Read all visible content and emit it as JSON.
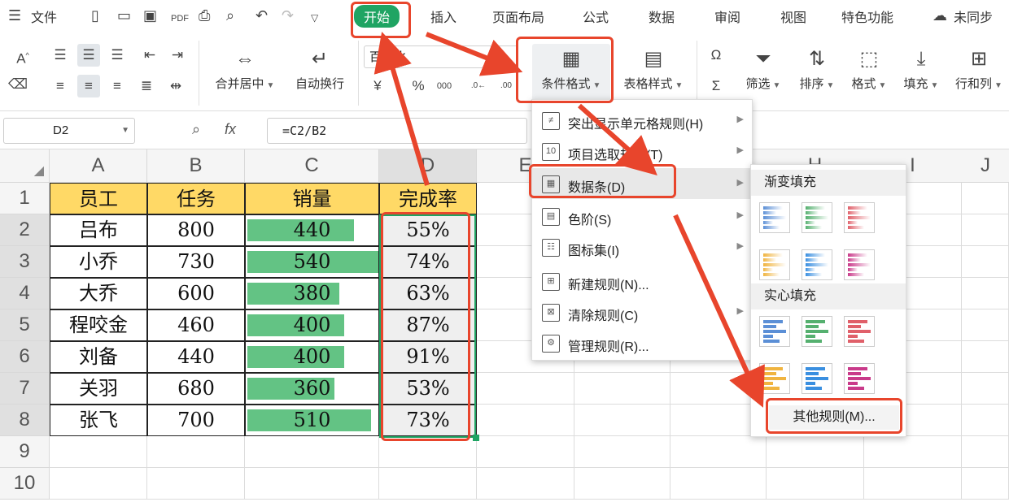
{
  "menubar": {
    "file_label": "文件",
    "tabs": [
      "开始",
      "插入",
      "页面布局",
      "公式",
      "数据",
      "审阅",
      "视图",
      "特色功能"
    ],
    "sync_label": "未同步"
  },
  "ribbon": {
    "merge_label": "合并居中",
    "wrap_label": "自动换行",
    "number_format": "百分比",
    "cond_format_label": "条件格式",
    "table_style_label": "表格样式",
    "filter_label": "筛选",
    "sort_label": "排序",
    "format_label": "格式",
    "fill_label": "填充",
    "rowcol_label": "行和列"
  },
  "formula_bar": {
    "name_box": "D2",
    "fx": "fx",
    "formula": "=C2/B2"
  },
  "columns": [
    "A",
    "B",
    "C",
    "D",
    "E",
    "H",
    "I",
    "J"
  ],
  "rows": [
    "1",
    "2",
    "3",
    "4",
    "5",
    "6",
    "7",
    "8",
    "9",
    "10"
  ],
  "table": {
    "headers": [
      "员工",
      "任务",
      "销量",
      "完成率"
    ],
    "data": [
      {
        "name": "吕布",
        "task": "800",
        "sales": "440",
        "rate": "55%",
        "bar": 0.55
      },
      {
        "name": "小乔",
        "task": "730",
        "sales": "540",
        "rate": "74%",
        "bar": 0.74
      },
      {
        "name": "大乔",
        "task": "600",
        "sales": "380",
        "rate": "63%",
        "bar": 0.63
      },
      {
        "name": "程咬金",
        "task": "460",
        "sales": "400",
        "rate": "87%",
        "bar": 0.87
      },
      {
        "name": "刘备",
        "task": "440",
        "sales": "400",
        "rate": "91%",
        "bar": 0.91
      },
      {
        "name": "关羽",
        "task": "680",
        "sales": "360",
        "rate": "53%",
        "bar": 0.53
      },
      {
        "name": "张飞",
        "task": "700",
        "sales": "510",
        "rate": "73%",
        "bar": 0.73
      }
    ]
  },
  "cond_menu": {
    "items": [
      "突出显示单元格规则(H)",
      "项目选取规则(T)",
      "数据条(D)",
      "色阶(S)",
      "图标集(I)",
      "新建规则(N)...",
      "清除规则(C)",
      "管理规则(R)..."
    ]
  },
  "databar_menu": {
    "gradient_title": "渐变填充",
    "solid_title": "实心填充",
    "more_rules": "其他规则(M)..."
  },
  "colors": {
    "accent_green": "#1fa463",
    "databar_green": "#63c384",
    "header_yellow": "#ffd966",
    "highlight_red": "#e8452c"
  }
}
